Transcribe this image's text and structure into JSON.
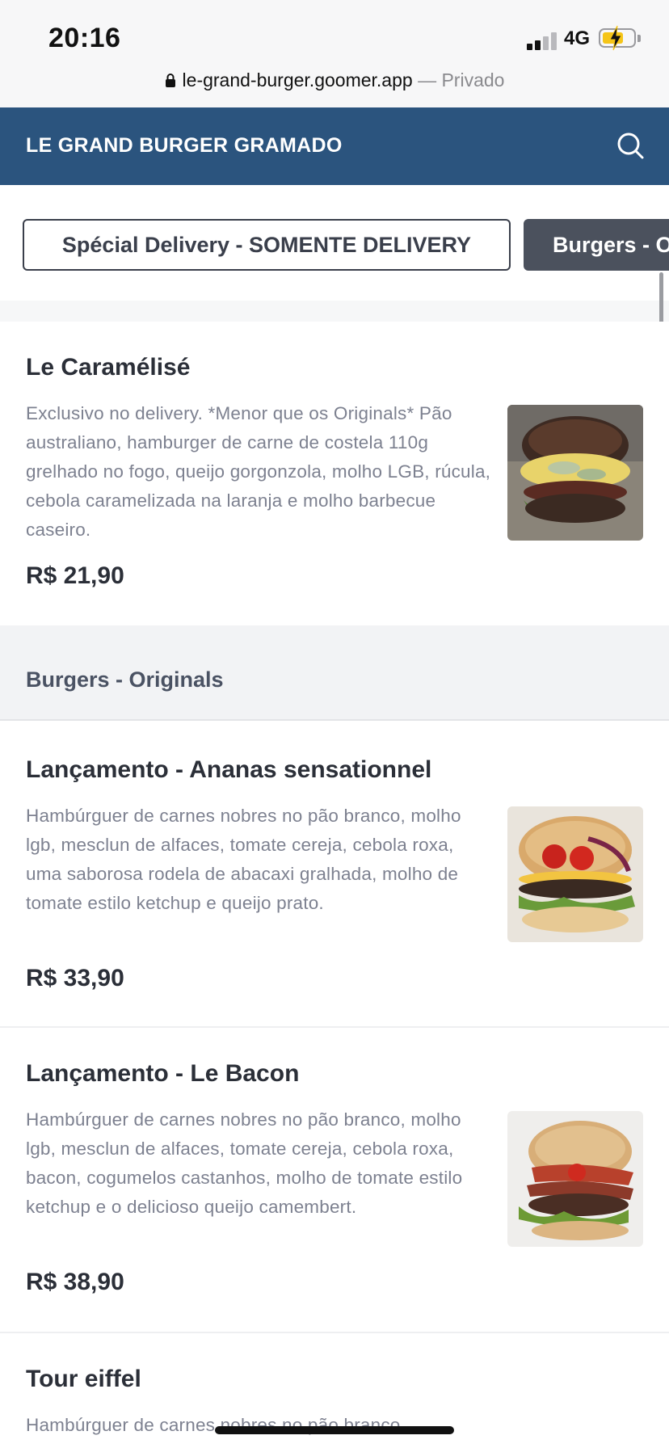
{
  "status_bar": {
    "time": "20:16",
    "network": "4G",
    "url": "le-grand-burger.goomer.app",
    "private_label": "— Privado"
  },
  "header": {
    "title": "LE GRAND BURGER GRAMADO"
  },
  "categories": [
    {
      "label": "Spécial Delivery - SOMENTE DELIVERY",
      "active": true
    },
    {
      "label": "Burgers - Originals",
      "active": false
    }
  ],
  "products_top": [
    {
      "name": "Le Caramélisé",
      "description": "Exclusivo no delivery. *Menor que os Originals* Pão australiano, hamburger de carne de costela 110g grelhado no fogo, queijo gorgonzola, molho LGB, rúcula, cebola caramelizada na laranja e molho barbecue caseiro.",
      "price": "R$ 21,90"
    }
  ],
  "section": {
    "title": "Burgers - Originals"
  },
  "products": [
    {
      "name": "Lançamento - Ananas sensationnel",
      "description": "Hambúrguer de carnes nobres no pão branco, molho lgb, mesclun de alfaces, tomate cereja, cebola roxa, uma saborosa rodela de abacaxi gralhada, molho de tomate estilo ketchup e queijo prato.",
      "price": "R$ 33,90"
    },
    {
      "name": "Lançamento - Le Bacon",
      "description": "Hambúrguer de carnes nobres no pão branco, molho lgb, mesclun de alfaces, tomate cereja, cebola roxa, bacon, cogumelos castanhos, molho de tomate estilo ketchup e o delicioso queijo camembert.",
      "price": "R$ 38,90"
    },
    {
      "name": "Tour eiffel",
      "description": "Hambúrguer de carnes nobres no pão branco,"
    }
  ],
  "colors": {
    "header_bg": "#2b547e",
    "chip_active_border": "#3a3f4b",
    "chip_inactive_bg": "#4b515d",
    "description_text": "#7d8190"
  },
  "icons": [
    "lock-icon",
    "search-icon",
    "signal-icon",
    "battery-icon"
  ]
}
